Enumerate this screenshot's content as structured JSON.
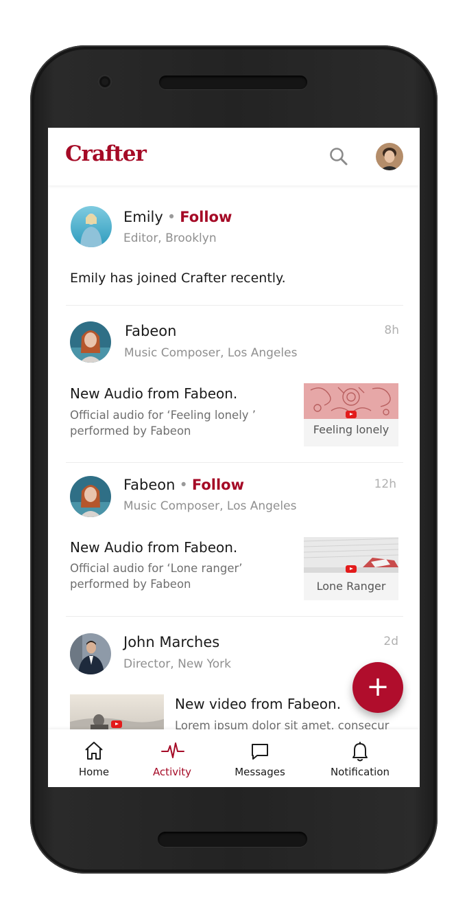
{
  "app": {
    "brand": "Crafter",
    "brand_color": "#a50a26"
  },
  "feed": [
    {
      "name": "Emily",
      "follow_label": "Follow",
      "subtitle": "Editor, Brooklyn",
      "text": "Emily has joined Crafter recently."
    },
    {
      "name": "Fabeon",
      "subtitle": "Music Composer, Los Angeles",
      "time": "8h",
      "title": "New Audio from Fabeon.",
      "description": "Official audio for ‘Feeling lonely ’ performed by Fabeon",
      "thumb_caption": "Feeling lonely"
    },
    {
      "name": "Fabeon",
      "follow_label": "Follow",
      "subtitle": "Music Composer, Los Angeles",
      "time": "12h",
      "title": "New Audio from Fabeon.",
      "description": "Official audio for ‘Lone ranger’ performed by Fabeon",
      "thumb_caption": "Lone Ranger"
    },
    {
      "name": "John Marches",
      "subtitle": "Director, New York",
      "time": "2d",
      "title": "New video from Fabeon.",
      "description": "Lorem ipsum dolor sit amet, consecur"
    }
  ],
  "fab": {
    "label": "+"
  },
  "nav": [
    {
      "label": "Home",
      "icon": "home-icon"
    },
    {
      "label": "Activity",
      "icon": "activity-icon",
      "active": true
    },
    {
      "label": "Messages",
      "icon": "message-icon"
    },
    {
      "label": "Notification",
      "icon": "bell-icon"
    }
  ]
}
